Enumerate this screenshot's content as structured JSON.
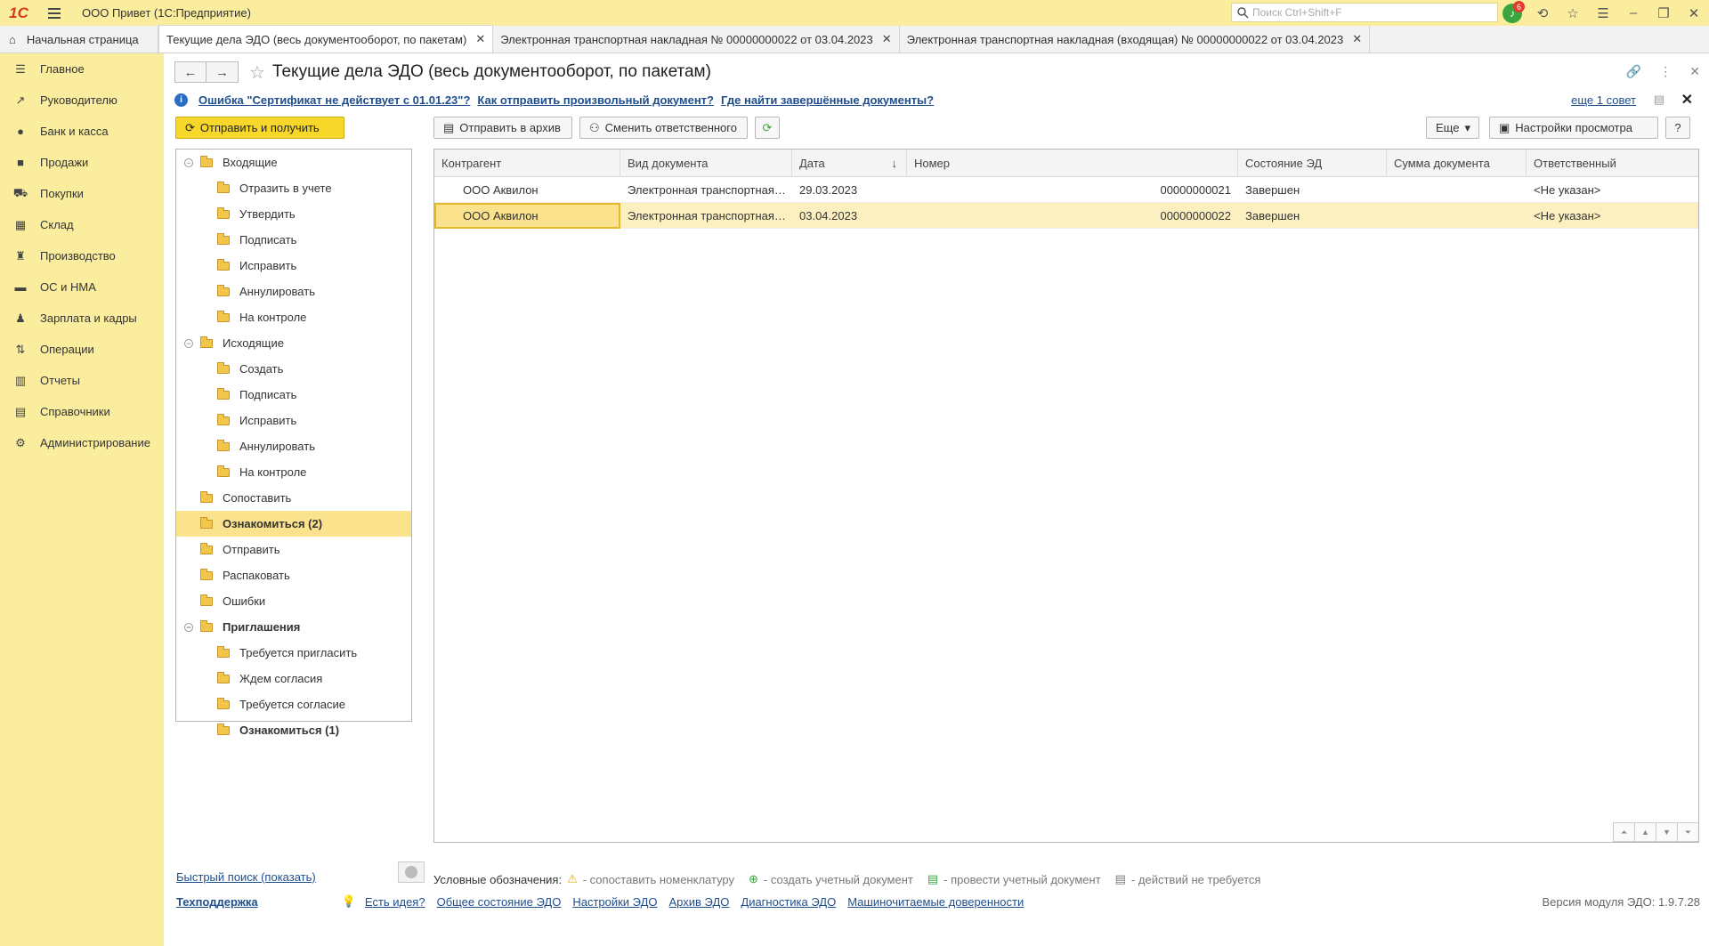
{
  "app": {
    "logo_text": "1С",
    "title": "ООО Привет  (1С:Предприятие)",
    "search_placeholder": "Поиск Ctrl+Shift+F",
    "notif_count": "6"
  },
  "tabs": [
    {
      "label": "Начальная страница"
    },
    {
      "label": "Текущие дела ЭДО (весь документооборот, по пакетам)"
    },
    {
      "label": "Электронная транспортная накладная № 00000000022 от 03.04.2023"
    },
    {
      "label": "Электронная транспортная накладная (входящая) № 00000000022 от 03.04.2023"
    }
  ],
  "sidebar": {
    "items": [
      {
        "label": "Главное",
        "icon": "menu-icon"
      },
      {
        "label": "Руководителю",
        "icon": "trend-icon"
      },
      {
        "label": "Банк и касса",
        "icon": "coin-icon"
      },
      {
        "label": "Продажи",
        "icon": "bag-icon"
      },
      {
        "label": "Покупки",
        "icon": "cart-icon"
      },
      {
        "label": "Склад",
        "icon": "grid-icon"
      },
      {
        "label": "Производство",
        "icon": "factory-icon"
      },
      {
        "label": "ОС и НМА",
        "icon": "truck-icon"
      },
      {
        "label": "Зарплата и кадры",
        "icon": "person-icon"
      },
      {
        "label": "Операции",
        "icon": "ops-icon"
      },
      {
        "label": "Отчеты",
        "icon": "chart-icon"
      },
      {
        "label": "Справочники",
        "icon": "book-icon"
      },
      {
        "label": "Администрирование",
        "icon": "gear-icon"
      }
    ]
  },
  "page": {
    "title": "Текущие дела ЭДО (весь документооборот, по пакетам)",
    "tips": [
      "Ошибка \"Сертификат не действует с 01.01.23\"?",
      "Как отправить произвольный документ?",
      "Где найти завершённые документы?"
    ],
    "more_tip": "еще 1 совет"
  },
  "toolbar": {
    "send_receive": "Отправить и получить",
    "archive": "Отправить в архив",
    "change_resp": "Сменить ответственного",
    "more": "Еще",
    "view_settings": "Настройки просмотра",
    "help": "?"
  },
  "tree": [
    {
      "label": "Входящие",
      "level": 0,
      "toggle": true
    },
    {
      "label": "Отразить в учете",
      "level": 1
    },
    {
      "label": "Утвердить",
      "level": 1
    },
    {
      "label": "Подписать",
      "level": 1
    },
    {
      "label": "Исправить",
      "level": 1
    },
    {
      "label": "Аннулировать",
      "level": 1
    },
    {
      "label": "На контроле",
      "level": 1
    },
    {
      "label": "Исходящие",
      "level": 0,
      "toggle": true
    },
    {
      "label": "Создать",
      "level": 1
    },
    {
      "label": "Подписать",
      "level": 1
    },
    {
      "label": "Исправить",
      "level": 1
    },
    {
      "label": "Аннулировать",
      "level": 1
    },
    {
      "label": "На контроле",
      "level": 1
    },
    {
      "label": "Сопоставить",
      "level": 0
    },
    {
      "label": "Ознакомиться (2)",
      "level": 0,
      "bold": true,
      "selected": true
    },
    {
      "label": "Отправить",
      "level": 0
    },
    {
      "label": "Распаковать",
      "level": 0
    },
    {
      "label": "Ошибки",
      "level": 0
    },
    {
      "label": "Приглашения",
      "level": 0,
      "toggle": true,
      "bold": true
    },
    {
      "label": "Требуется пригласить",
      "level": 1
    },
    {
      "label": "Ждем согласия",
      "level": 1
    },
    {
      "label": "Требуется согласие",
      "level": 1
    },
    {
      "label": "Ознакомиться (1)",
      "level": 1,
      "bold": true
    }
  ],
  "table": {
    "columns": [
      "Контрагент",
      "Вид документа",
      "Дата",
      "Номер",
      "Состояние ЭД",
      "Сумма документа",
      "Ответственный"
    ],
    "rows": [
      [
        "ООО Аквилон",
        "Электронная транспортная…",
        "29.03.2023",
        "00000000021",
        "Завершен",
        "",
        "<Не указан>"
      ],
      [
        "ООО Аквилон",
        "Электронная транспортная…",
        "03.04.2023",
        "00000000022",
        "Завершен",
        "",
        "<Не указан>"
      ]
    ],
    "selected_row": 1
  },
  "legend": {
    "title": "Условные обозначения:",
    "items": [
      "- сопоставить номенклатуру",
      "- создать учетный документ",
      "- провести учетный документ",
      "- действий не требуется"
    ]
  },
  "quick_search": "Быстрый поиск (показать)",
  "footer": {
    "support": "Техподдержка",
    "links": [
      "Есть идея?",
      "Общее состояние ЭДО",
      "Настройки ЭДО",
      "Архив ЭДО",
      "Диагностика ЭДО",
      "Машиночитаемые доверенности"
    ],
    "version": "Версия модуля ЭДО: 1.9.7.28"
  }
}
